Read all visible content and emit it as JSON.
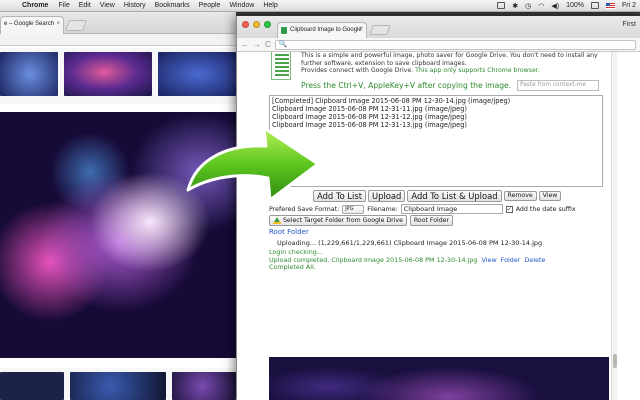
{
  "menubar": {
    "apple": "",
    "app": "Chrome",
    "items": [
      "File",
      "Edit",
      "View",
      "History",
      "Bookmarks",
      "People",
      "Window",
      "Help"
    ],
    "battery": "100%",
    "clock": "Fri 2"
  },
  "back_window": {
    "tab_title": "e – Google Search",
    "tab_close": "×"
  },
  "front_window": {
    "tab_title": "Clipboard Image to Google",
    "tab_close": "×",
    "user": "First",
    "nav_back": "←",
    "nav_forward": "→",
    "reload": "C",
    "address_icon": "🔍"
  },
  "app": {
    "description_line1": "This is a simple and powerful image, photo saver for Google Drive. You don't need to install any",
    "description_line2": "further software, extension to save clipboard images.",
    "description_line3a": "Provides connect with Google Drive.",
    "description_line3b": " This app only supports Chrome browser.",
    "press_hint": "Press the Ctrl+V, AppleKey+V after copying the image.",
    "paste_placeholder": "Paste from context-me",
    "list_items": [
      "[Completed] Clipboard Image 2015-06-08 PM 12-30-14.jpg (image/jpeg)",
      "Clipboard Image 2015-06-08 PM 12-31-11.jpg (image/jpeg)",
      "Clipboard Image 2015-06-08 PM 12-31-12.jpg (image/jpeg)",
      "Clipboard Image 2015-06-08 PM 12-31-13.jpg (image/jpeg)"
    ],
    "buttons": {
      "add_to_list": "Add To List",
      "upload": "Upload",
      "add_and_upload": "Add To List & Upload",
      "remove": "Remove",
      "view": "View"
    },
    "format_label": "Prefered Save Format:",
    "format_value": "JPG",
    "filename_label": "Filename:",
    "filename_value": "Clipboard Image",
    "date_suffix_label": "Add the date suffix",
    "date_suffix_checked": "✓",
    "select_folder_button": "Select Target Folder from Google Drive",
    "root_folder_button": "Root Folder",
    "root_folder_link": "Root Folder",
    "uploading_text": "Uploading... (1,229,661/1,229,661) Clipboard Image 2015-06-08 PM 12-30-14.jpg",
    "login_status": "Login checking...",
    "upload_completed": "Upload completed. Clipboard Image 2015-06-08 PM 12-30-14.jpg",
    "link_view": "View",
    "link_folder": "Folder",
    "link_delete": "Delete",
    "completed_all": "Completed All."
  },
  "colors": {
    "green_text": "#2e8b2e",
    "link_blue": "#2256c4",
    "arrow_green": "#5dc71e"
  }
}
